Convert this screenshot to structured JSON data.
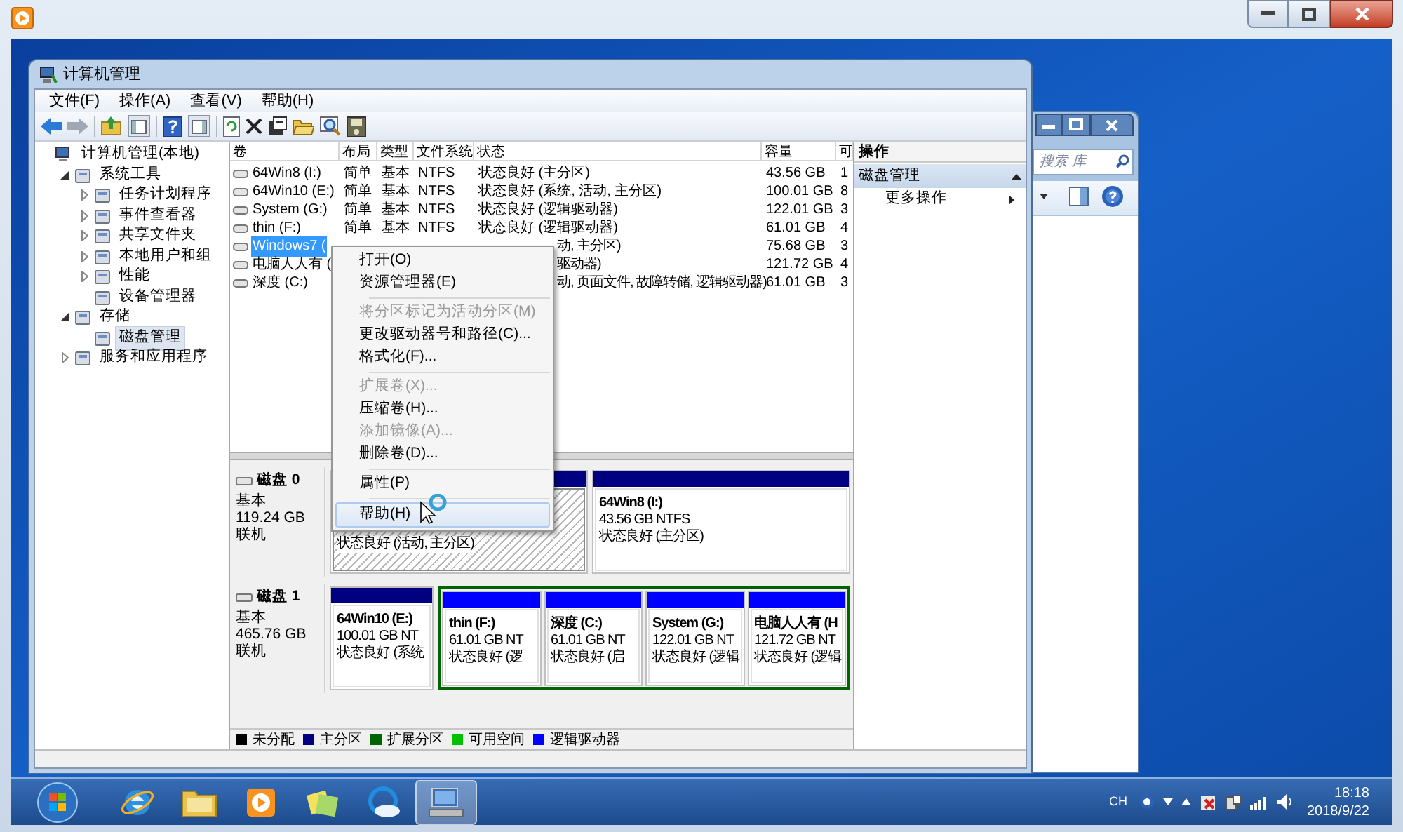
{
  "cm_window": {
    "title": "计算机管理",
    "menu": [
      "文件(F)",
      "操作(A)",
      "查看(V)",
      "帮助(H)"
    ],
    "tree": [
      {
        "label": "计算机管理(本地)",
        "selected": false,
        "children": [
          {
            "label": "系统工具",
            "expanded": true,
            "selected": false,
            "children": [
              {
                "label": "任务计划程序",
                "expanded": false,
                "selected": false
              },
              {
                "label": "事件查看器",
                "expanded": false,
                "selected": false
              },
              {
                "label": "共享文件夹",
                "expanded": false,
                "selected": false
              },
              {
                "label": "本地用户和组",
                "expanded": false,
                "selected": false
              },
              {
                "label": "性能",
                "expanded": false,
                "selected": false
              },
              {
                "label": "设备管理器",
                "selected": false
              }
            ]
          },
          {
            "label": "存储",
            "expanded": true,
            "selected": false,
            "children": [
              {
                "label": "磁盘管理",
                "selected": true
              }
            ]
          },
          {
            "label": "服务和应用程序",
            "expanded": false,
            "selected": false
          }
        ]
      }
    ],
    "volumes": {
      "columns": [
        "卷",
        "布局",
        "类型",
        "文件系统",
        "状态",
        "容量",
        "可"
      ],
      "rows": [
        {
          "volume": "64Win8  (I:)",
          "layout": "简单",
          "type": "基本",
          "fs": "NTFS",
          "status": "状态良好 (主分区)",
          "capacity": "43.56 GB",
          "column_7": "1",
          "selected": false,
          "covered": false
        },
        {
          "volume": "64Win10 (E:)",
          "layout": "简单",
          "type": "基本",
          "fs": "NTFS",
          "status": "状态良好 (系统, 活动, 主分区)",
          "capacity": "100.01 GB",
          "column_7": "8",
          "selected": false,
          "covered": false
        },
        {
          "volume": "System (G:)",
          "layout": "简单",
          "type": "基本",
          "fs": "NTFS",
          "status": "状态良好 (逻辑驱动器)",
          "capacity": "122.01 GB",
          "column_7": "3",
          "selected": false,
          "covered": false
        },
        {
          "volume": "thin (F:)",
          "layout": "简单",
          "type": "基本",
          "fs": "NTFS",
          "status": "状态良好 (逻辑驱动器)",
          "capacity": "61.01 GB",
          "column_7": "4",
          "selected": false,
          "covered": false
        },
        {
          "volume": "Windows7 (",
          "status": "动, 主分区)",
          "capacity": "75.68 GB",
          "column_7": "3",
          "selected": true,
          "covered": true
        },
        {
          "volume": "电脑人人有 (",
          "status": "驱动器)",
          "capacity": "121.72 GB",
          "column_7": "4",
          "selected": false,
          "covered": true
        },
        {
          "volume": "深度 (C:)",
          "status": "动, 页面文件, 故障转储, 逻辑驱动器)",
          "capacity": "61.01 GB",
          "column_7": "3",
          "selected": false,
          "covered": true
        }
      ]
    },
    "disks": [
      {
        "name": "磁盘 0",
        "type": "基本",
        "size": "119.24 GB",
        "state": "联机",
        "partitions": [
          {
            "kind": "primary",
            "selected": true,
            "covered": true,
            "status": "状态良好 (活动, 主分区)"
          },
          {
            "kind": "primary",
            "selected": false,
            "covered": false,
            "name": "64Win8 (I:)",
            "size": "43.56 GB NTFS",
            "status": "状态良好 (主分区)"
          }
        ]
      },
      {
        "name": "磁盘 1",
        "type": "基本",
        "size": "465.76 GB",
        "state": "联机",
        "partitions": [
          {
            "kind": "primary",
            "selected": false,
            "covered": false,
            "name": "64Win10 (E:)",
            "size": "100.01 GB NT",
            "status": "状态良好 (系统"
          },
          {
            "kind": "extended",
            "children": [
              {
                "kind": "logical",
                "selected": false,
                "covered": false,
                "name": "thin (F:)",
                "size": "61.01 GB NT",
                "status": "状态良好 (逻"
              },
              {
                "kind": "logical",
                "selected": false,
                "covered": false,
                "name": "深度 (C:)",
                "size": "61.01 GB NT",
                "status": "状态良好 (启"
              },
              {
                "kind": "logical",
                "selected": false,
                "covered": false,
                "name": "System (G:)",
                "size": "122.01 GB NT",
                "status": "状态良好 (逻辑"
              },
              {
                "kind": "logical",
                "selected": false,
                "covered": false,
                "name": "电脑人人有 (H",
                "size": "121.72 GB NT",
                "status": "状态良好 (逻辑"
              }
            ]
          }
        ]
      }
    ],
    "legend": [
      {
        "label": "未分配",
        "color": "#000000"
      },
      {
        "label": "主分区",
        "color": "#000080"
      },
      {
        "label": "扩展分区",
        "color": "#006400"
      },
      {
        "label": "可用空间",
        "color": "#00c000"
      },
      {
        "label": "逻辑驱动器",
        "color": "#0000ff"
      }
    ],
    "actions": {
      "title": "操作",
      "section": "磁盘管理",
      "items": [
        "更多操作"
      ]
    }
  },
  "context_menu": [
    {
      "kind": "item",
      "label": "打开(O)",
      "disabled": false,
      "selected": false
    },
    {
      "kind": "item",
      "label": "资源管理器(E)",
      "disabled": false,
      "selected": false
    },
    {
      "kind": "separator"
    },
    {
      "kind": "item",
      "label": "将分区标记为活动分区(M)",
      "disabled": true,
      "selected": false
    },
    {
      "kind": "item",
      "label": "更改驱动器号和路径(C)...",
      "disabled": false,
      "selected": false
    },
    {
      "kind": "item",
      "label": "格式化(F)...",
      "disabled": false,
      "selected": false
    },
    {
      "kind": "separator"
    },
    {
      "kind": "item",
      "label": "扩展卷(X)...",
      "disabled": true,
      "selected": false
    },
    {
      "kind": "item",
      "label": "压缩卷(H)...",
      "disabled": false,
      "selected": false
    },
    {
      "kind": "item",
      "label": "添加镜像(A)...",
      "disabled": true,
      "selected": false
    },
    {
      "kind": "item",
      "label": "删除卷(D)...",
      "disabled": false,
      "selected": false
    },
    {
      "kind": "separator"
    },
    {
      "kind": "item",
      "label": "属性(P)",
      "disabled": false,
      "selected": false
    },
    {
      "kind": "separator"
    },
    {
      "kind": "item",
      "label": "帮助(H)",
      "disabled": false,
      "selected": true
    }
  ],
  "explorer_window": {
    "search": {
      "placeholder": "搜索 库"
    }
  },
  "taskbar": {
    "apps": [
      {
        "kind": "ie",
        "selected": false
      },
      {
        "kind": "folder",
        "selected": false
      },
      {
        "kind": "player",
        "selected": false
      },
      {
        "kind": "notes",
        "selected": false
      },
      {
        "kind": "cloud",
        "selected": false
      },
      {
        "kind": "computer",
        "selected": true
      }
    ],
    "tray": {
      "lang": "CH",
      "time": "18:18",
      "date": "2018/9/22"
    }
  }
}
